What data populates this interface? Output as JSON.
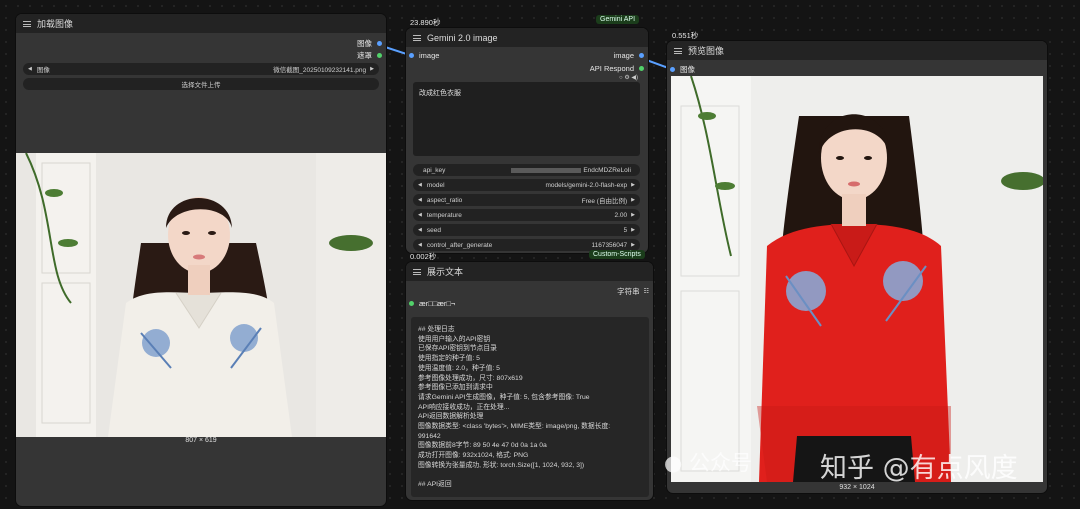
{
  "load_image": {
    "title": "加载图像",
    "outputs": [
      "图像",
      "遮罩"
    ],
    "image_widget": {
      "label": "图像",
      "value": "微信截图_20250109232141.png"
    },
    "upload_button": "选择文件上传",
    "caption": "807 × 619"
  },
  "gemini": {
    "timing": "23.890秒",
    "badge": "Gemini API",
    "title": "Gemini 2.0 image",
    "input": "image",
    "outputs": [
      "image",
      "API Respond"
    ],
    "prompt": "改成红色衣服",
    "widgets": [
      {
        "label": "api_key",
        "value": "EndcMDZReLoIi"
      },
      {
        "label": "model",
        "value": "models/gemini-2.0-flash-exp"
      },
      {
        "label": "aspect_ratio",
        "value": "Free (自由比例)"
      },
      {
        "label": "temperature",
        "value": "2.00"
      },
      {
        "label": "seed",
        "value": "5"
      },
      {
        "label": "control_after_generate",
        "value": "1167356047"
      }
    ]
  },
  "show_text": {
    "timing": "0.002秒",
    "badge": "Custom-Scripts",
    "title": "展示文本",
    "output": "字符串",
    "input_label": "ær□□ær□¬",
    "log_lines": [
      "## 处理日志",
      "使用用户输入的API密钥",
      "已保存API密钥到节点目录",
      "使用指定的种子值: 5",
      "使用温度值: 2.0，种子值: 5",
      "参考图像处理成功，尺寸: 807x619",
      "参考图像已添加到请求中",
      "请求Gemini API生成图像，种子值: 5, 包含参考图像: True",
      "API响应接收成功，正在处理...",
      "API返回数据解析处理",
      "图像数据类型: <class 'bytes'>, MIME类型: image/png, 数据长度:",
      "991642",
      "图像数据前8字节: 89 50 4e 47 0d 0a 1a 0a",
      "成功打开图像: 932x1024, 格式: PNG",
      "图像转换为张量成功, 形状: torch.Size([1, 1024, 932, 3])",
      "",
      "## API返回"
    ]
  },
  "preview": {
    "timing": "0.551秒",
    "title": "预览图像",
    "input": "图像",
    "caption": "932 × 1024"
  },
  "watermark": {
    "text": "知乎 @有点风度",
    "secondary": "公众号"
  },
  "colors": {
    "node_bg": "#353535",
    "title_bg": "#232323",
    "link_blue": "#5aa0ff",
    "slot_green": "#52d16a",
    "shirt_red": "#e0201c"
  }
}
